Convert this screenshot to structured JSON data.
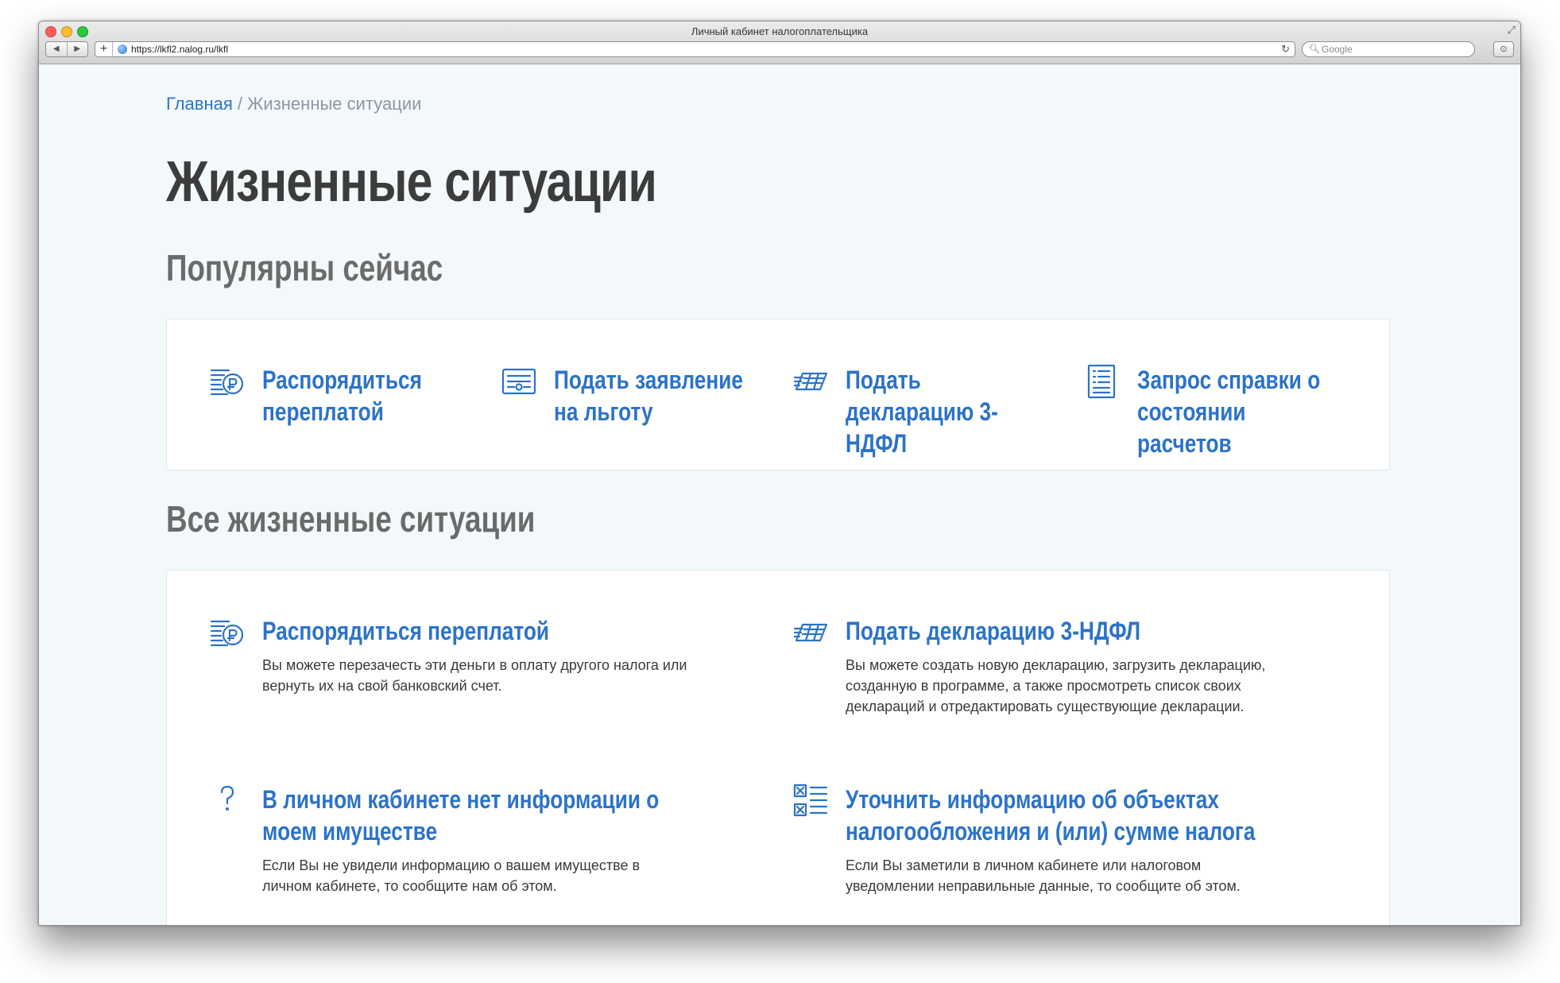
{
  "window": {
    "title": "Личный кабинет налогоплательщика",
    "url": "https://lkfl2.nalog.ru/lkfl",
    "search_placeholder": "Google"
  },
  "breadcrumb": {
    "home": "Главная",
    "separator": " / ",
    "current": "Жизненные ситуации"
  },
  "page_title": "Жизненные ситуации",
  "popular": {
    "heading": "Популярны сейчас",
    "items": [
      {
        "label": "Распорядиться переплатой",
        "icon": "overpayment-icon"
      },
      {
        "label": "Подать заявление на льготу",
        "icon": "benefit-application-icon"
      },
      {
        "label": "Подать декларацию 3-НДФЛ",
        "icon": "declaration-icon"
      },
      {
        "label": "Запрос справки о состоянии расчетов",
        "icon": "certificate-request-icon"
      }
    ]
  },
  "all": {
    "heading": "Все жизненные ситуации",
    "items": [
      {
        "title": "Распорядиться переплатой",
        "desc": "Вы можете перезачесть эти деньги в оплату другого налога или вернуть их на свой банковский счет.",
        "icon": "overpayment-icon"
      },
      {
        "title": "Подать декларацию 3-НДФЛ",
        "desc": "Вы можете создать новую декларацию, загрузить декларацию, созданную в программе, а также просмотреть список своих деклараций и отредактировать существующие декларации.",
        "icon": "declaration-icon"
      },
      {
        "title": "В личном кабинете нет информации о моем имуществе",
        "desc": "Если Вы не увидели информацию о вашем имуществе в личном кабинете, то сообщите нам об этом.",
        "icon": "question-icon"
      },
      {
        "title": "Уточнить информацию об объектах налогообложения и (или) сумме налога",
        "desc": "Если Вы заметили в личном кабинете или налоговом уведомлении неправильные данные, то сообщите об этом.",
        "icon": "checklist-icon"
      }
    ]
  },
  "colors": {
    "accent": "#2c73c8",
    "page_bg": "#f3f8fb",
    "heading": "#3c3c3c",
    "subheading": "#6b6b6b"
  }
}
